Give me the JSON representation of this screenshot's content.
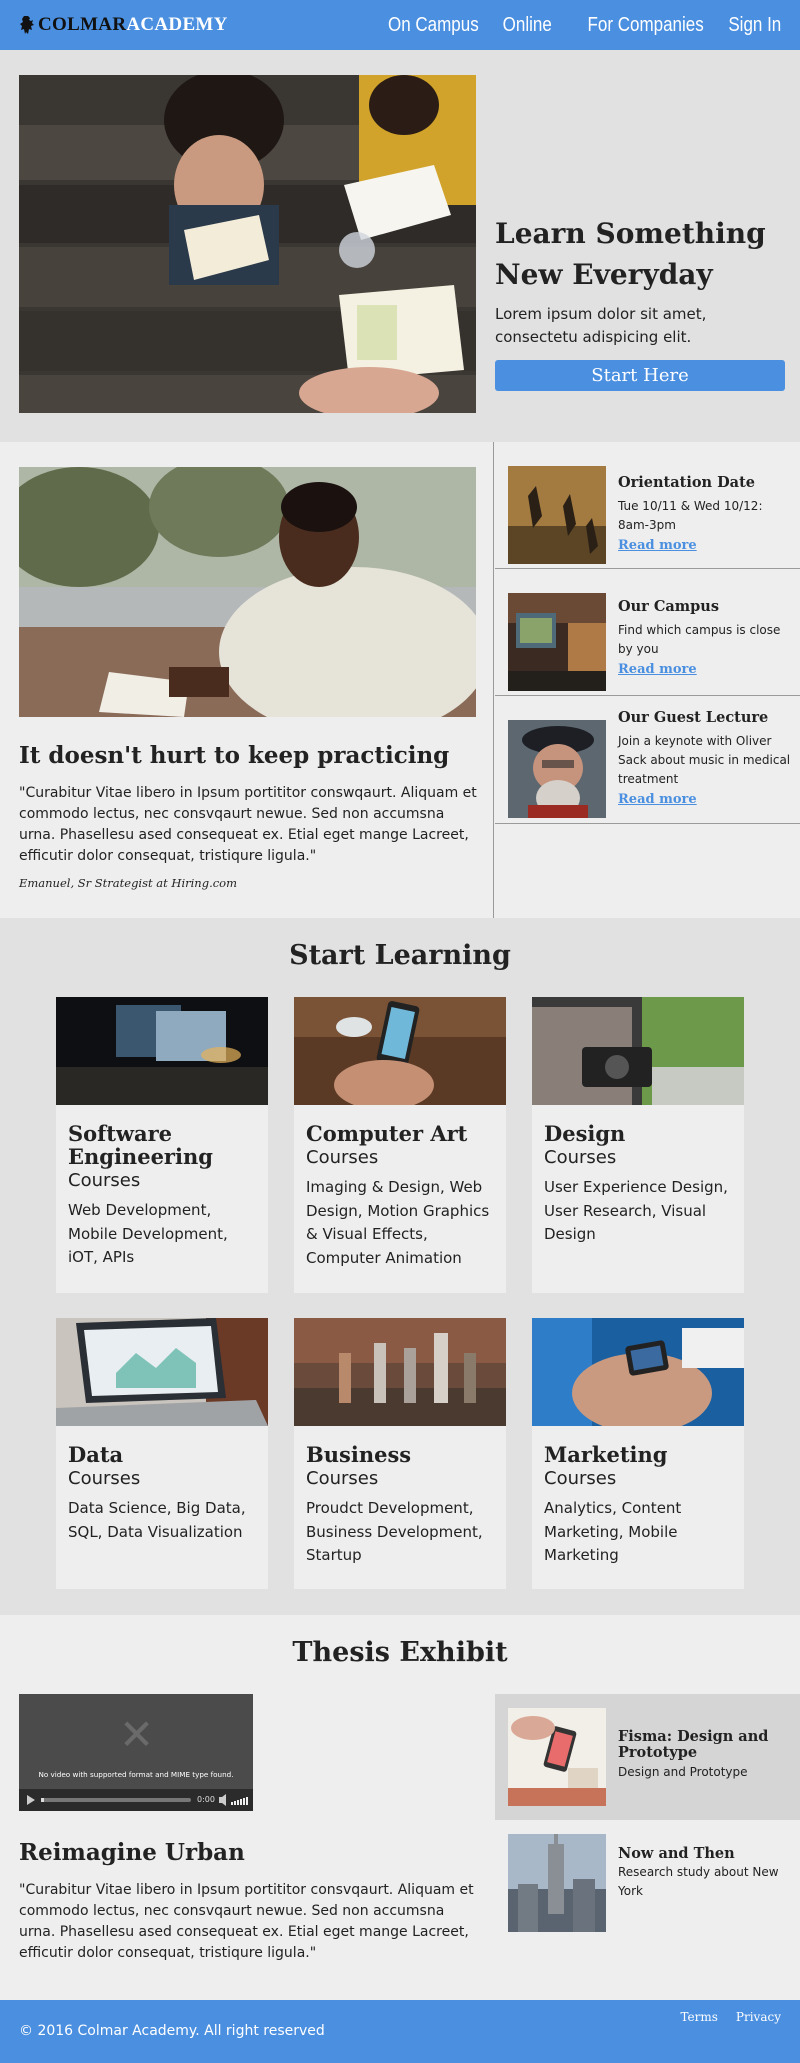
{
  "header": {
    "logo_colmar": "COLMAR",
    "logo_academy": "ACADEMY",
    "nav": [
      "On Campus",
      "Online",
      "For Companies",
      "Sign In"
    ]
  },
  "hero": {
    "title": "Learn Something New Everyday",
    "subtitle": "Lorem ipsum dolor sit amet, consectetu adispicing elit.",
    "button": "Start Here"
  },
  "feature": {
    "title": "It doesn't hurt to keep practicing",
    "quote": "\"Curabitur Vitae libero in Ipsum portititor conswqaurt. Aliquam et commodo lectus, nec consvqaurt newue. Sed non accumsna urna. Phasellesu ased consequeat ex. Etial eget mange Lacreet, efficutir dolor consequat, tristiqure ligula.\"",
    "author": "Emanuel, Sr Strategist at Hiring.com"
  },
  "events": [
    {
      "title": "Orientation Date",
      "desc": "Tue 10/11 & Wed 10/12: 8am-3pm",
      "link": "Read more"
    },
    {
      "title": "Our Campus",
      "desc": "Find which campus is close by you",
      "link": "Read more"
    },
    {
      "title": "Our Guest Lecture",
      "desc": "Join a keynote with Oliver Sack about music in medical treatment",
      "link": "Read more"
    }
  ],
  "learning": {
    "title": "Start Learning",
    "courses": [
      {
        "title": "Software Engineering",
        "sub": "Courses",
        "desc": "Web Development, Mobile Development, iOT, APIs"
      },
      {
        "title": "Computer Art",
        "sub": "Courses",
        "desc": "Imaging & Design, Web Design, Motion Graphics & Visual Effects, Computer Animation"
      },
      {
        "title": "Design",
        "sub": "Courses",
        "desc": "User Experience Design, User Research, Visual Design"
      },
      {
        "title": "Data",
        "sub": "Courses",
        "desc": "Data Science, Big Data, SQL, Data Visualization"
      },
      {
        "title": "Business",
        "sub": "Courses",
        "desc": "Proudct Development, Business Development, Startup"
      },
      {
        "title": "Marketing",
        "sub": "Courses",
        "desc": "Analytics, Content Marketing, Mobile Marketing"
      }
    ]
  },
  "thesis": {
    "title": "Thesis Exhibit",
    "video_message": "No video with supported format and MIME type found.",
    "video_time": "0:00",
    "project_title": "Reimagine Urban",
    "quote": "\"Curabitur Vitae libero in Ipsum portititor consvqaurt. Aliquam et commodo lectus, nec consvqaurt newue. Sed non accumsna urna. Phasellesu ased consequeat ex. Etial eget mange Lacreet, efficutir dolor consequat, tristiqure ligula.\"",
    "exhibits": [
      {
        "title": "Fisma: Design and Prototype",
        "desc": "Design and Prototype"
      },
      {
        "title": "Now and Then",
        "desc": "Research study about New York"
      }
    ]
  },
  "footer": {
    "copyright": "© 2016 Colmar Academy. All right reserved",
    "links": [
      "Terms",
      "Privacy"
    ]
  },
  "colors": {
    "accent": "#4a8fe0",
    "section_dark": "#e1e1e1",
    "section_light": "#eeeeee"
  }
}
